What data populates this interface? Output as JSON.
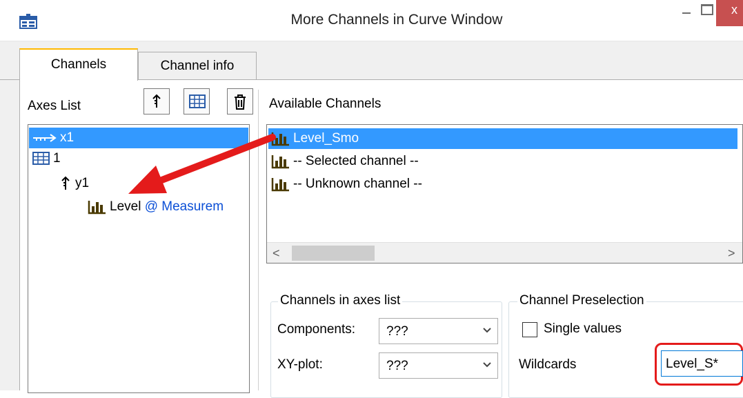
{
  "window": {
    "title": "More Channels in Curve Window",
    "close_glyph": "x"
  },
  "tabs": [
    {
      "label": "Channels",
      "active": true
    },
    {
      "label": "Channel info",
      "active": false
    }
  ],
  "axes_panel": {
    "label": "Axes List",
    "toolbar": [
      {
        "icon": "y-axis-icon"
      },
      {
        "icon": "grid-icon"
      },
      {
        "icon": "trash-icon"
      }
    ],
    "tree": [
      {
        "label": "x1",
        "icon": "x-axis-icon",
        "selected": true
      },
      {
        "label": "1",
        "icon": "grid-icon",
        "selected": false
      },
      {
        "label": "y1",
        "icon": "y-axis-icon",
        "selected": false
      },
      {
        "label": "Level",
        "suffix": "@ Measurem",
        "icon": "channel-icon",
        "selected": false
      }
    ]
  },
  "available": {
    "label": "Available Channels",
    "items": [
      {
        "label": "Level_Smo",
        "selected": true
      },
      {
        "label": "-- Selected channel --",
        "selected": false
      },
      {
        "label": "-- Unknown channel --",
        "selected": false
      }
    ],
    "scroll_left": "<",
    "scroll_right": ">"
  },
  "channels_in_axes": {
    "title": "Channels in axes list",
    "components_label": "Components:",
    "components_value": "???",
    "xy_label": "XY-plot:",
    "xy_value": "???"
  },
  "preselection": {
    "title": "Channel Preselection",
    "single_values_label": "Single values",
    "single_values_checked": false,
    "wildcards_label": "Wildcards",
    "wildcards_value": "Level_S*"
  },
  "colors": {
    "selection": "#3399ff",
    "annotation_red": "#e41b1b",
    "active_tab_accent": "#ffb900",
    "link_blue": "#0b4fd6"
  }
}
